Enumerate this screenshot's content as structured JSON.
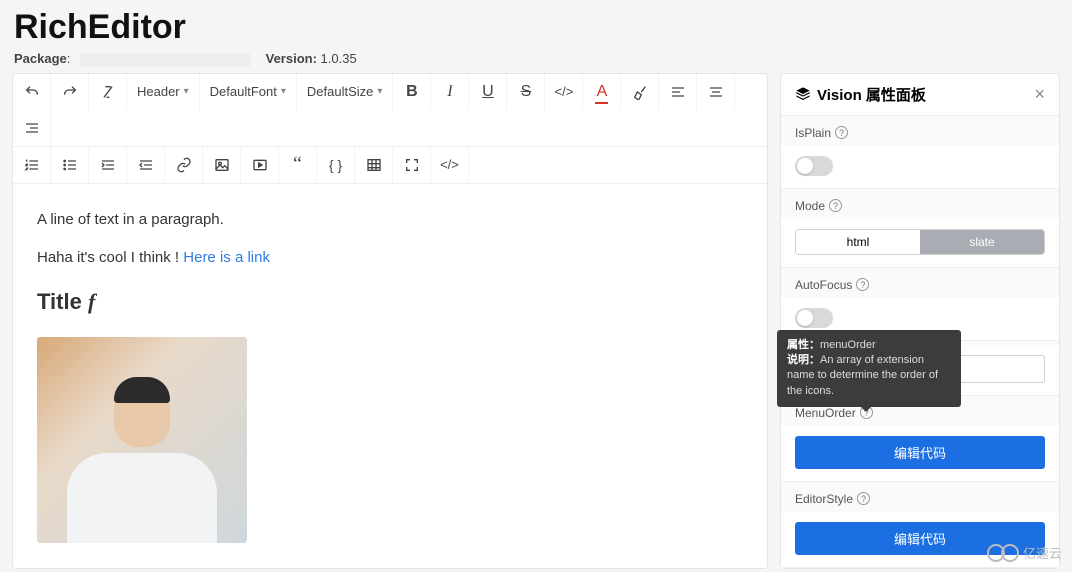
{
  "header": {
    "title": "RichEditor",
    "package_label": "Package",
    "version_label": "Version:",
    "version_value": "1.0.35"
  },
  "toolbar": {
    "header": "Header",
    "font": "DefaultFont",
    "size": "DefaultSize"
  },
  "content": {
    "p1": "A line of text in a paragraph.",
    "p2_a": "Haha it's cool I think ! ",
    "p2_link": "Here is a link",
    "title_text": "Title ",
    "title_f": "f"
  },
  "panel": {
    "title": "Vision 属性面板",
    "props": {
      "isPlain": "IsPlain",
      "mode": "Mode",
      "mode_html": "html",
      "mode_slate": "slate",
      "autoFocus": "AutoFocus",
      "menuOrder": "MenuOrder",
      "editorStyle": "EditorStyle",
      "editCode": "编辑代码"
    }
  },
  "tooltip": {
    "attr_label": "属性：",
    "attr_value": "menuOrder",
    "desc_label": "说明：",
    "desc_value": "An array of extension name to determine the order of the icons."
  },
  "watermark": "亿速云"
}
